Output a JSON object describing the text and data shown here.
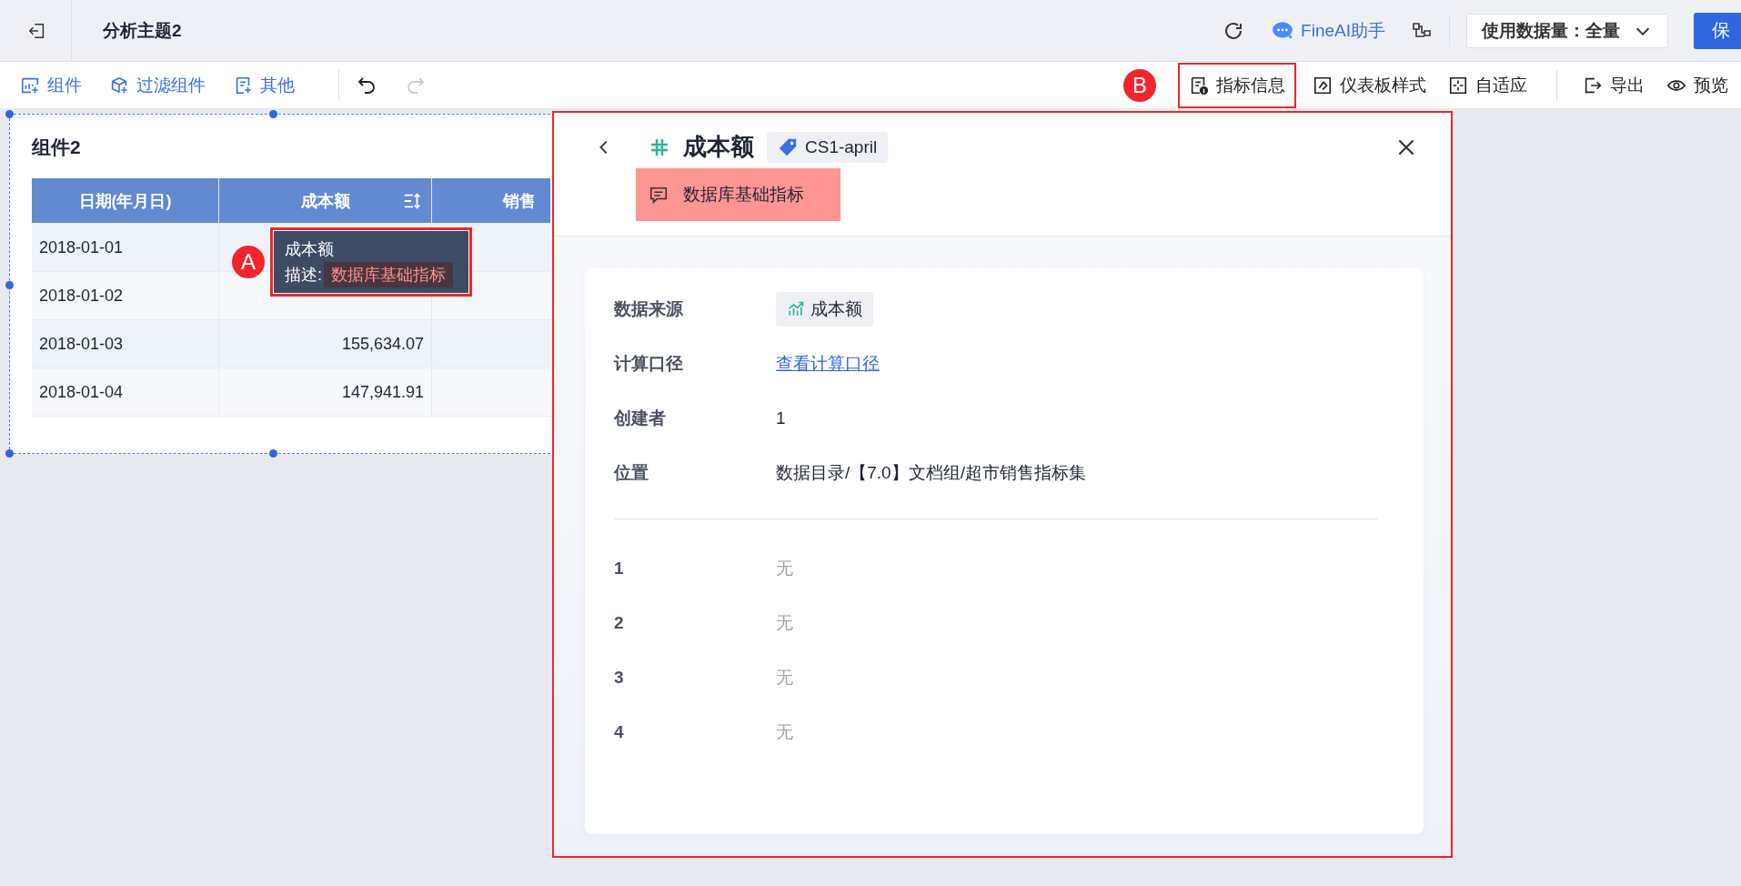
{
  "top_bar": {
    "title": "分析主题2",
    "assistant": "FineAI助手",
    "data_volume": "使用数据量：全量",
    "save_button": "保"
  },
  "toolbar": {
    "left": [
      {
        "label": "组件",
        "kind": "chart"
      },
      {
        "label": "过滤组件",
        "kind": "filter"
      },
      {
        "label": "其他",
        "kind": "other"
      }
    ],
    "history": [
      {
        "kind": "undo",
        "disabled": false
      },
      {
        "kind": "redo",
        "disabled": true
      }
    ],
    "right": [
      {
        "label": "指标信息",
        "kind": "info",
        "annotation": "B"
      },
      {
        "label": "仪表板样式",
        "kind": "style"
      },
      {
        "label": "自适应",
        "kind": "fit"
      },
      {
        "label": "导出",
        "kind": "export"
      },
      {
        "label": "预览",
        "kind": "preview"
      }
    ]
  },
  "widget": {
    "title": "组件2",
    "columns": [
      {
        "label": "日期(年月日)",
        "sortable": false
      },
      {
        "label": "成本额",
        "sortable": true
      },
      {
        "label": "销售",
        "sortable": false
      }
    ],
    "rows": [
      {
        "date": "2018-01-01"
      },
      {
        "date": "2018-01-02"
      },
      {
        "date": "2018-01-03",
        "cost": "155,634.07"
      },
      {
        "date": "2018-01-04",
        "cost": "147,941.91"
      }
    ],
    "tooltip": {
      "title": "成本额",
      "label": "描述:",
      "value": "数据库基础指标",
      "annotation": "A"
    }
  },
  "panel": {
    "title": "成本额",
    "tag": "CS1-april",
    "description": "数据库基础指标",
    "fields": [
      {
        "label": "数据来源",
        "value": "成本额",
        "kind": "source"
      },
      {
        "label": "计算口径",
        "value": "查看计算口径",
        "kind": "link"
      },
      {
        "label": "创建者",
        "value": "1",
        "kind": "text"
      },
      {
        "label": "位置",
        "value": "数据目录/【7.0】文档组/超市销售指标集",
        "kind": "text"
      }
    ],
    "custom_fields": [
      {
        "label": "1",
        "value": "无"
      },
      {
        "label": "2",
        "value": "无"
      },
      {
        "label": "3",
        "value": "无"
      },
      {
        "label": "4",
        "value": "无"
      }
    ]
  }
}
